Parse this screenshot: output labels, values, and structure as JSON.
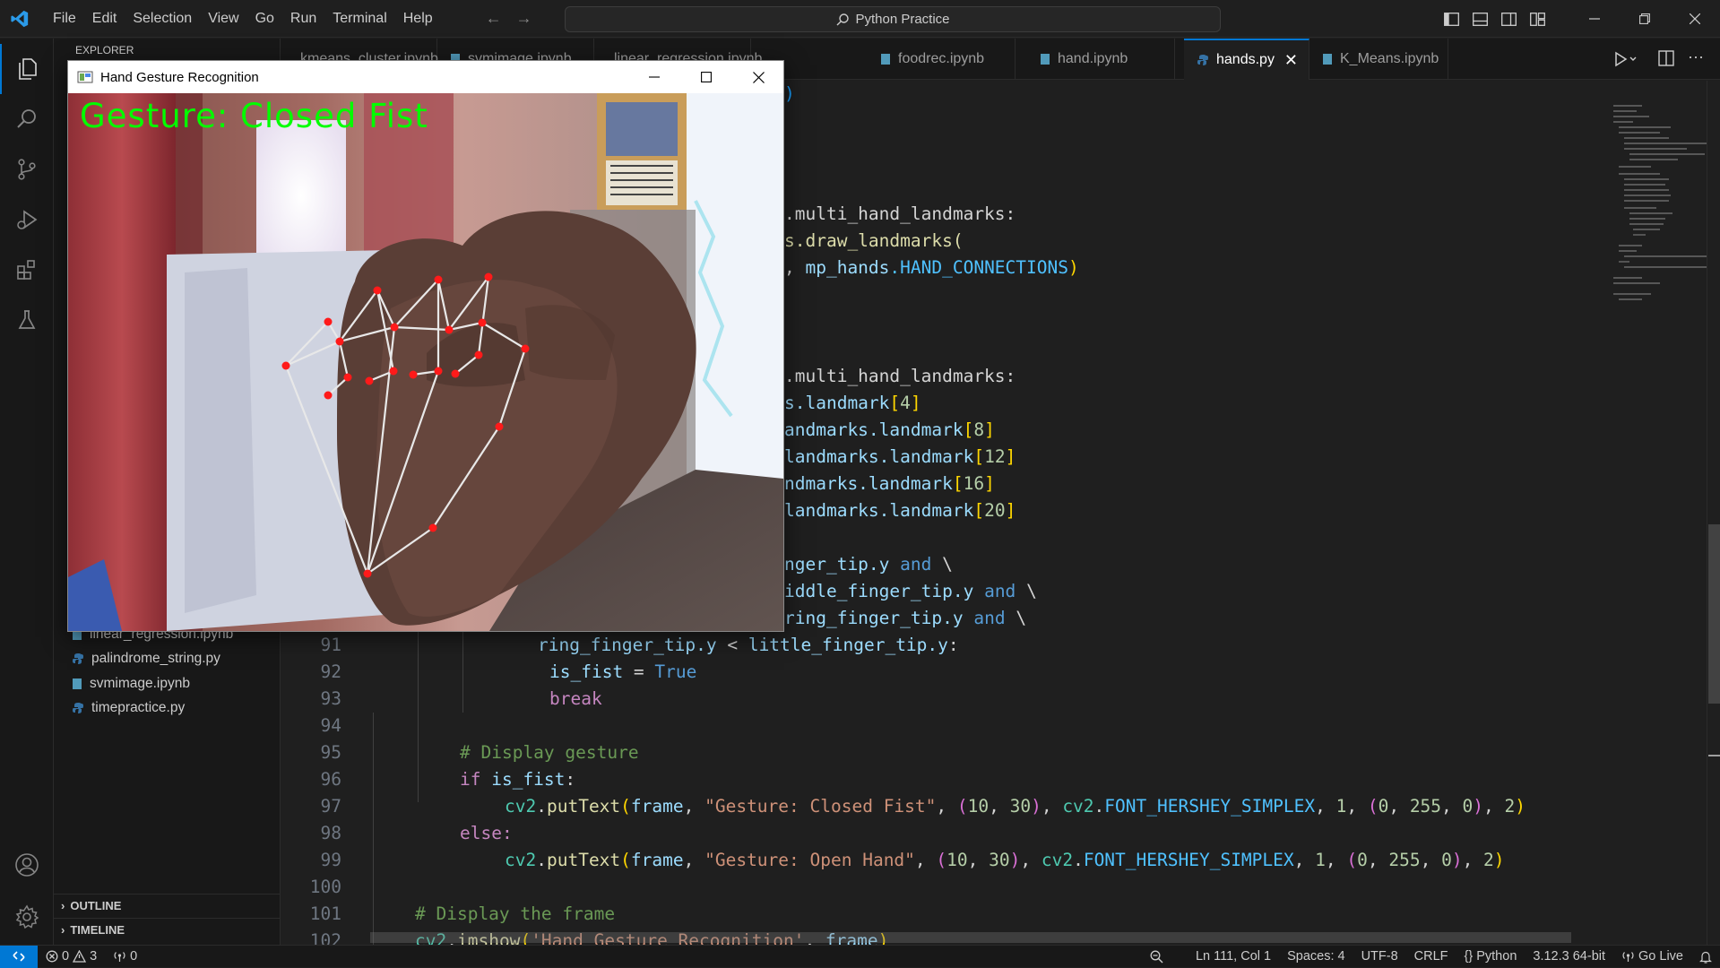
{
  "titlebar": {
    "menu": [
      "File",
      "Edit",
      "Selection",
      "View",
      "Go",
      "Run",
      "Terminal",
      "Help"
    ],
    "search": "Python Practice"
  },
  "sidebar": {
    "explorer_title": "EXPLORER",
    "files": [
      {
        "name": "linear_regression.ipynb",
        "type": "notebook"
      },
      {
        "name": "palindrome_string.py",
        "type": "python"
      },
      {
        "name": "svmimage.ipynb",
        "type": "notebook"
      },
      {
        "name": "timepractice.py",
        "type": "python"
      }
    ],
    "outline": "OUTLINE",
    "timeline": "TIMELINE"
  },
  "tabs": [
    {
      "label": "kmeans_cluster.ipynb",
      "type": "notebook"
    },
    {
      "label": "svmimage.ipynb",
      "type": "notebook"
    },
    {
      "label": "linear_regression.ipynb",
      "type": "notebook"
    },
    {
      "label": "foodrec.ipynb",
      "type": "notebook"
    },
    {
      "label": "hand.ipynb",
      "type": "notebook"
    },
    {
      "label": "hands.py",
      "type": "python",
      "active": true
    },
    {
      "label": "K_Means.ipynb",
      "type": "notebook"
    }
  ],
  "code_visible_fragments": {
    "l1": ")",
    "l2a": ".multi_hand_landmarks:",
    "l2b": "s.draw_landmarks(",
    "l2c_a": ", ",
    "l2c_b": "mp_hands",
    "l2c_c": ".HAND_CONNECTIONS",
    "l2c_d": ")",
    "l3a": ".multi_hand_landmarks:",
    "l3b": "s.landmark",
    "l3b_idx": "4",
    "l3c": "andmarks.landmark",
    "l3c_idx": "8",
    "l3d": "landmarks.landmark",
    "l3d_idx": "12",
    "l3e": "ndmarks.landmark",
    "l3e_idx": "16",
    "l3f": "landmarks.landmark",
    "l3f_idx": "20",
    "l4a": "nger_tip.y",
    "l4b": "iddle_finger_tip.y",
    "l4c": "ring_finger_tip.y",
    "and": "and",
    "bs": "\\"
  },
  "code_lines": [
    {
      "n": "91"
    },
    {
      "n": "92"
    },
    {
      "n": "93"
    },
    {
      "n": "94"
    },
    {
      "n": "95"
    },
    {
      "n": "96"
    },
    {
      "n": "97"
    },
    {
      "n": "98"
    },
    {
      "n": "99"
    },
    {
      "n": "100"
    },
    {
      "n": "101"
    },
    {
      "n": "102"
    }
  ],
  "code_text": {
    "c91a": "ring_finger_tip.y",
    "c91b": " < ",
    "c91c": "little_finger_tip.y",
    "c91d": ":",
    "c92a": "is_fist",
    "c92b": " = ",
    "c92c": "True",
    "c93": "break",
    "c95": "# Display gesture",
    "c96a": "if",
    "c96b": " is_fist",
    "c96c": ":",
    "c97_fn": "cv2",
    "c97_put": "putText",
    "c97_frame": "frame",
    "c97_str": "\"Gesture: Closed Fist\"",
    "c98": "else:",
    "c99_str": "\"Gesture: Open Hand\"",
    "c_font": "FONT_HERSHEY_SIMPLEX",
    "c_ten": "10",
    "c_thirty": "30",
    "c_one": "1",
    "c_zero": "0",
    "c_255": "255",
    "c_two": "2",
    "c101": "# Display the frame",
    "c102a": "cv2",
    "c102b": "imshow",
    "c102c": "'Hand Gesture Recognition'",
    "c102d": "frame"
  },
  "gesture_window": {
    "title": "Hand Gesture Recognition",
    "overlay_text": "Gesture: Closed Fist",
    "overlay_color": "#00ff00",
    "landmark_color": "#ff0000"
  },
  "statusbar": {
    "errors": "0",
    "warnings": "3",
    "ports": "0",
    "position": "Ln 111, Col 1",
    "spaces": "Spaces: 4",
    "encoding": "UTF-8",
    "eol": "CRLF",
    "language": "Python",
    "interpreter": "3.12.3 64-bit",
    "golive": "Go Live"
  },
  "colors": {
    "accent": "#0078d4",
    "editor_bg": "#1f1f1f",
    "sidebar_bg": "#181818"
  }
}
